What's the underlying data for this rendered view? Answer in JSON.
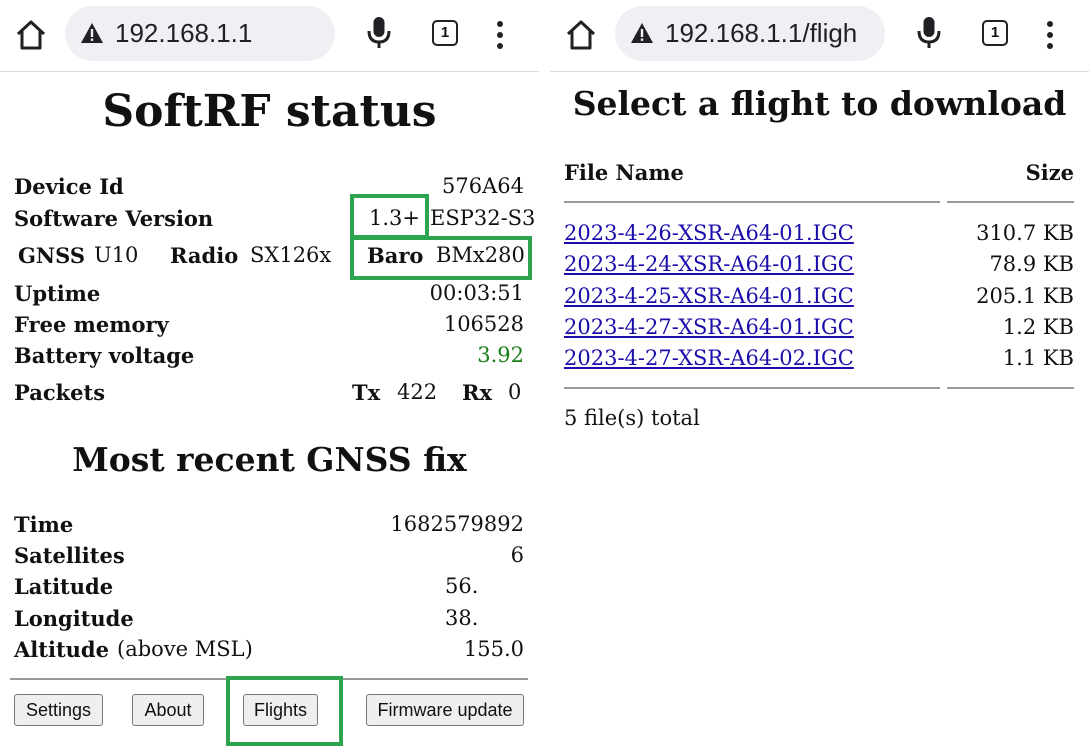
{
  "browser_left": {
    "url": "192.168.1.1",
    "tab_count": "1"
  },
  "browser_right": {
    "url": "192.168.1.1/fligh",
    "tab_count": "1"
  },
  "status_page": {
    "title": "SoftRF status",
    "device_id": {
      "label": "Device Id",
      "value": "576A64"
    },
    "software_version": {
      "label": "Software Version",
      "value": "1.3+",
      "platform": "ESP32-S3"
    },
    "hardware": {
      "gnss_label": "GNSS",
      "gnss_value": "U10",
      "radio_label": "Radio",
      "radio_value": "SX126x",
      "baro_label": "Baro",
      "baro_value": "BMx280"
    },
    "uptime": {
      "label": "Uptime",
      "value": "00:03:51"
    },
    "free_memory": {
      "label": "Free memory",
      "value": "106528"
    },
    "battery_voltage": {
      "label": "Battery voltage",
      "value": "3.92"
    },
    "packets": {
      "label": "Packets",
      "tx_label": "Tx",
      "tx_value": "422",
      "rx_label": "Rx",
      "rx_value": "0"
    },
    "gnss_fix_title": "Most recent GNSS fix",
    "gnss_fix": {
      "time": {
        "label": "Time",
        "value": "1682579892"
      },
      "satellites": {
        "label": "Satellites",
        "value": "6"
      },
      "latitude": {
        "label": "Latitude",
        "value": "56."
      },
      "longitude": {
        "label": "Longitude",
        "value": "38."
      },
      "altitude": {
        "label": "Altitude",
        "unit": "(above MSL)",
        "value": "155.0"
      }
    },
    "buttons": {
      "settings": "Settings",
      "about": "About",
      "flights": "Flights",
      "firmware_update": "Firmware update"
    },
    "colors": {
      "highlight": "#2ea44f",
      "battery": "#1a7f1a"
    }
  },
  "flights_page": {
    "title": "Select a flight to download",
    "columns": {
      "name": "File Name",
      "size": "Size"
    },
    "files": [
      {
        "name": "2023-4-26-XSR-A64-01.IGC",
        "size": "310.7 KB"
      },
      {
        "name": "2023-4-24-XSR-A64-01.IGC",
        "size": "78.9 KB"
      },
      {
        "name": "2023-4-25-XSR-A64-01.IGC",
        "size": "205.1 KB"
      },
      {
        "name": "2023-4-27-XSR-A64-01.IGC",
        "size": "1.2 KB"
      },
      {
        "name": "2023-4-27-XSR-A64-02.IGC",
        "size": "1.1 KB"
      }
    ],
    "total": "5 file(s) total",
    "link_color": "#1a0dab"
  },
  "icons": [
    "home-icon",
    "warning-icon",
    "mic-icon",
    "tabs-icon",
    "more-vert-icon"
  ]
}
